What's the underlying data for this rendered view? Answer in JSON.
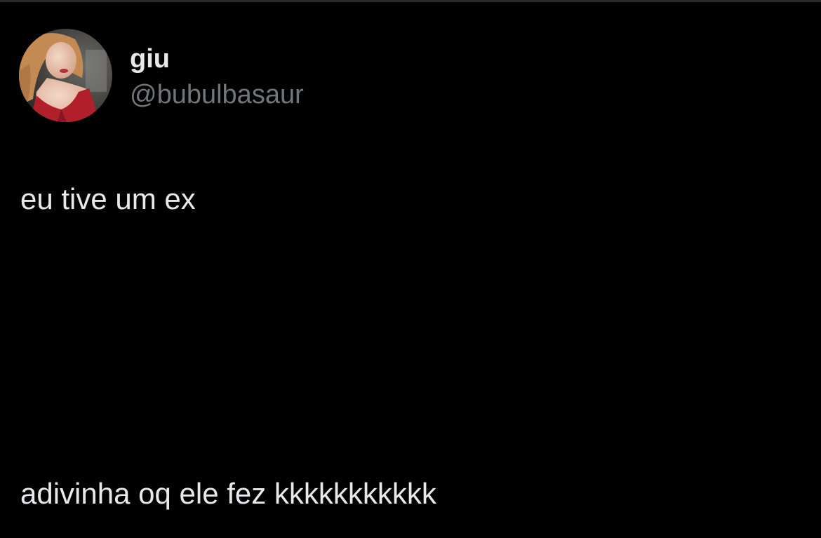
{
  "tweet": {
    "author": {
      "display_name": "giu",
      "handle": "@bubulbasaur",
      "avatar": "profile-photo"
    },
    "text_lines": [
      "eu tive um ex",
      "adivinha oq ele fez kkkkkkkkkkk"
    ]
  },
  "colors": {
    "background": "#000000",
    "primary_text": "#e7e9ea",
    "secondary_text": "#71767b"
  }
}
